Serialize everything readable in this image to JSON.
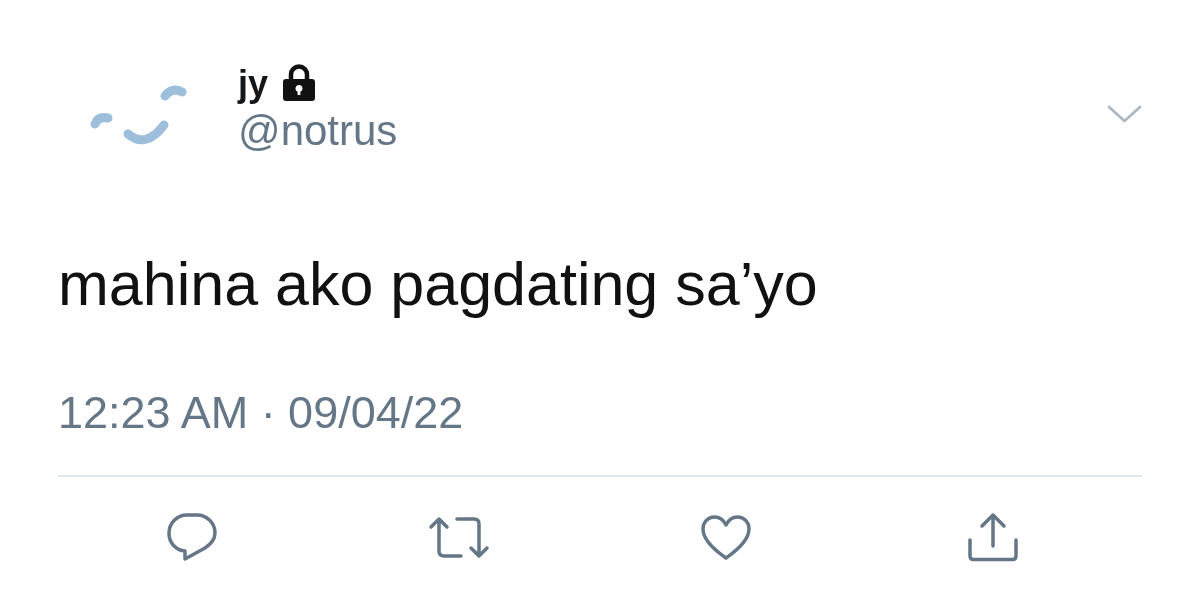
{
  "tweet": {
    "author": {
      "display_name": "jy",
      "protected": true,
      "handle": "@notrus"
    },
    "text": "mahina ako pagdating sa’yo",
    "timestamp": "12:23 AM · 09/04/22"
  },
  "actions": [
    {
      "kind": "reply"
    },
    {
      "kind": "retweet"
    },
    {
      "kind": "like"
    },
    {
      "kind": "share"
    }
  ]
}
